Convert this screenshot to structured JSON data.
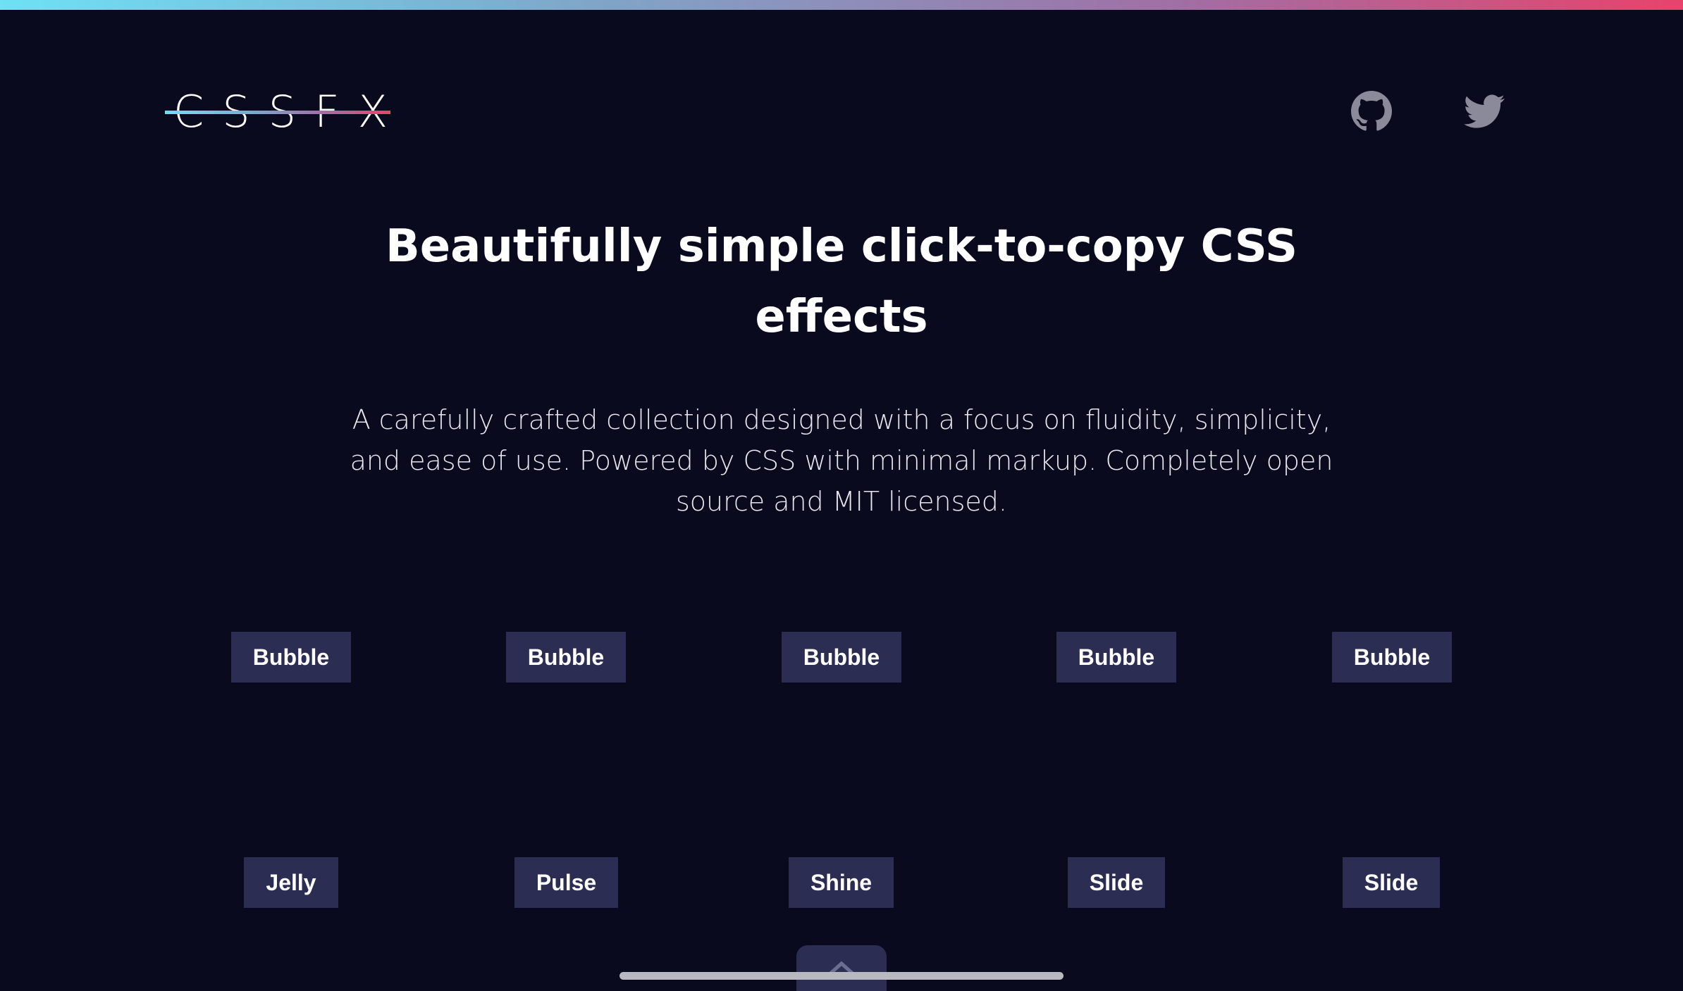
{
  "header": {
    "logo_text": "CSSFX",
    "github_icon": "github-icon",
    "twitter_icon": "twitter-icon"
  },
  "hero": {
    "title_line1": "Beautifully simple click-to-copy CSS",
    "title_line2": "effects",
    "desc_line1": "A carefully crafted collection designed with a focus on fluidity, simplicity,",
    "desc_line2": "and ease of use. Powered by CSS with minimal markup. Completely open",
    "desc_line3": "source and MIT licensed."
  },
  "effects": {
    "row1": [
      "Bubble",
      "Bubble",
      "Bubble",
      "Bubble",
      "Bubble"
    ],
    "row2": [
      "Jelly",
      "Pulse",
      "Shine",
      "Slide",
      "Slide"
    ]
  },
  "colors": {
    "background": "#0a0a1f",
    "button_bg": "#2b2e52",
    "accent_start": "#6ee1f5",
    "accent_end": "#e8436b",
    "icon_gray": "#8a8a9a"
  },
  "footer": {
    "scroll_top_icon": "chevron-up-icon"
  }
}
